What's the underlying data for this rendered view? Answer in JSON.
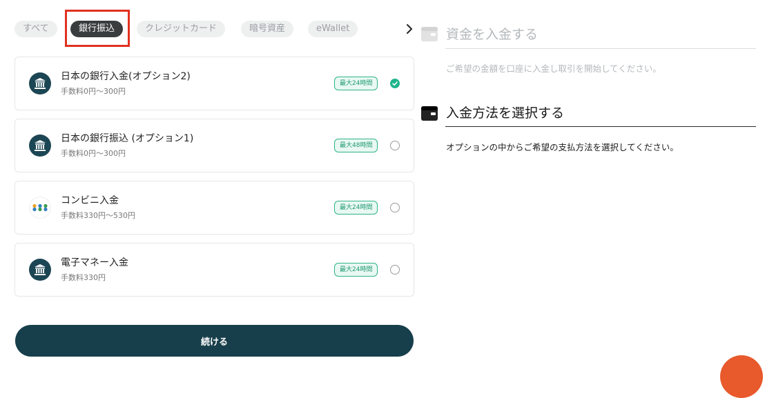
{
  "tabs": [
    {
      "label": "すべて",
      "active": false
    },
    {
      "label": "銀行振込",
      "active": true
    },
    {
      "label": "クレジットカード",
      "active": false
    },
    {
      "label": "暗号資産",
      "active": false
    },
    {
      "label": "eWallet",
      "active": false
    }
  ],
  "tabs_next_icon": "chevron-right-icon",
  "methods": [
    {
      "name": "日本の銀行入金(オプション2)",
      "fee": "手数料0円〜300円",
      "badge": "最大24時間",
      "selected": true,
      "icon": "bank-icon"
    },
    {
      "name": "日本の銀行振込 (オプション1)",
      "fee": "手数料0円〜300円",
      "badge": "最大48時間",
      "selected": false,
      "icon": "bank-icon"
    },
    {
      "name": "コンビニ入金",
      "fee": "手数料330円〜530円",
      "badge": "最大24時間",
      "selected": false,
      "icon": "konbini-icon"
    },
    {
      "name": "電子マネー入金",
      "fee": "手数料330円",
      "badge": "最大24時間",
      "selected": false,
      "icon": "bank-icon"
    }
  ],
  "continue_label": "続ける",
  "steps": [
    {
      "title": "資金を入金する",
      "description": "ご希望の金額を口座に入金し取引を開始してください。",
      "active": false,
      "icon": "wallet-icon"
    },
    {
      "title": "入金方法を選択する",
      "description": "オプションの中からご希望の支払方法を選択してください。",
      "active": true,
      "icon": "wallet-icon"
    }
  ],
  "colors": {
    "primary": "#173f4b",
    "accent_green": "#1fb58c",
    "highlight_red": "#e0311f",
    "chat_orange": "#e8592c"
  }
}
